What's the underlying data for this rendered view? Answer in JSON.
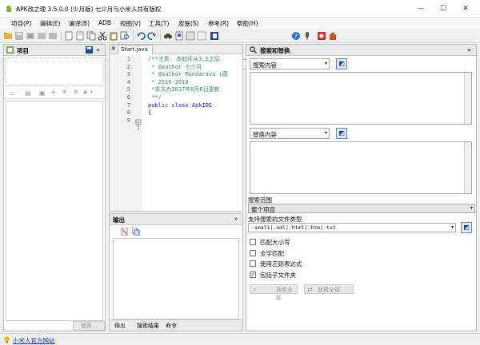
{
  "window": {
    "title": "APK改之理 3.5.0.0 (少月版)  七少月与小米人共有版权",
    "controls": [
      "—",
      "☐",
      "✕"
    ]
  },
  "menu": [
    {
      "label": "项目(P)"
    },
    {
      "label": "编辑(E)"
    },
    {
      "label": "编译(B)"
    },
    {
      "label": "ADB"
    },
    {
      "label": "视图(V)"
    },
    {
      "label": "工具(T)"
    },
    {
      "label": "皮肤(S)"
    },
    {
      "label": "参考(R)"
    },
    {
      "label": "帮助(H)"
    }
  ],
  "toolbar": {
    "encoding": "utf-8"
  },
  "project_panel": {
    "title": "项目",
    "replace_button": "替换..."
  },
  "editor": {
    "tab_label": "Start.java",
    "line_numbers": [
      "1",
      "2",
      "3",
      "4",
      "5",
      "6",
      "7",
      "8",
      "9"
    ],
    "lines": [
      "/**注意: 本软件从3.2之后",
      " * @author 七少月",
      " * @author Mandarava (圆",
      " * 2016-2018",
      " *本次为2017年8月6日更新",
      " **/",
      "public class ApkIDE",
      "{",
      ""
    ],
    "colors": {
      "comment": "#2e8b57",
      "keyword": "#2222cc",
      "text": "#000000"
    }
  },
  "output_panel": {
    "title": "输出",
    "tabs": [
      "输出",
      "搜索结果",
      "命令"
    ]
  },
  "search_panel": {
    "title": "搜索和替换",
    "search_label": "搜索内容",
    "replace_label": "替换内容",
    "scope_label": "搜索范围",
    "scope_value": "整个项目",
    "filetypes_label": "支持搜索的文件类型",
    "filetypes_value": ".smali|.xml|.html|.htm|.txt",
    "options": [
      {
        "label": "匹配大小写",
        "checked": false
      },
      {
        "label": "全字匹配",
        "checked": false
      },
      {
        "label": "使用正则表达式",
        "checked": false
      },
      {
        "label": "包括子文件夹",
        "checked": true
      }
    ],
    "search_all": "搜索全部",
    "replace_all": "替换全部"
  },
  "status_bar": {
    "link": "小米人官方网站"
  }
}
